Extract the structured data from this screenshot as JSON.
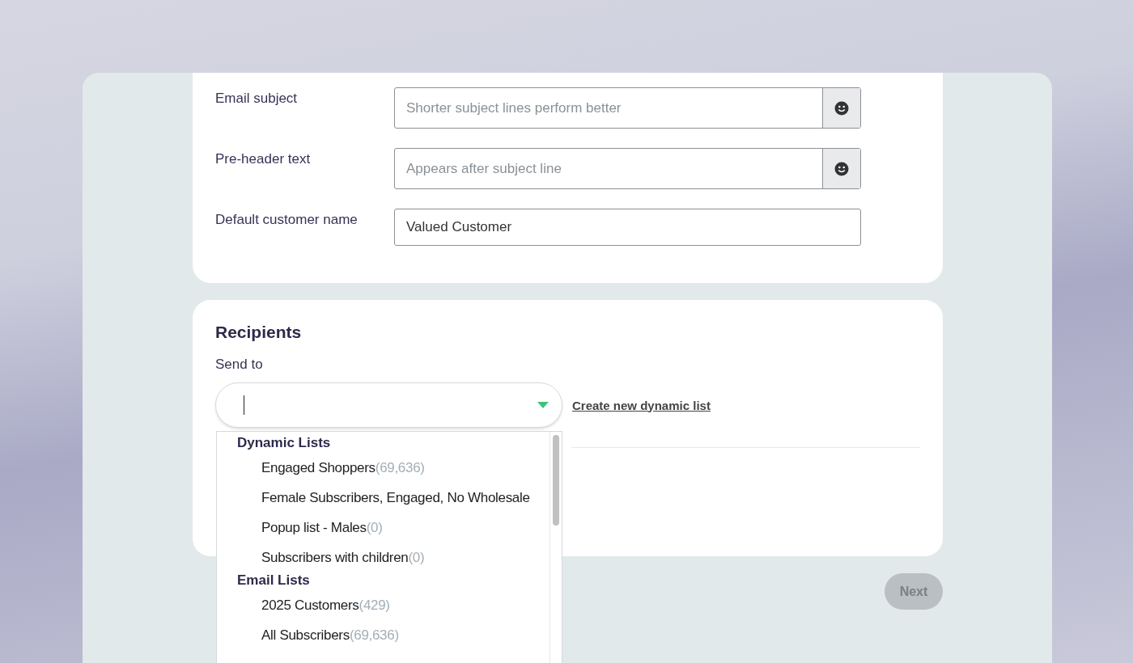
{
  "details": {
    "fields": [
      {
        "label": "Email subject",
        "placeholder": "Shorter subject lines perform better",
        "emoji": true
      },
      {
        "label": "Pre-header text",
        "placeholder": "Appears after subject line",
        "emoji": true
      },
      {
        "label": "Default customer name",
        "value": "Valued Customer",
        "emoji": false
      }
    ]
  },
  "recipients": {
    "title": "Recipients",
    "send_to_label": "Send to",
    "select": {
      "expanded": true
    },
    "create_link": "Create new dynamic list",
    "groups": [
      {
        "name": "Dynamic Lists",
        "items": [
          {
            "name": "Engaged Shoppers",
            "count": "(69,636)"
          },
          {
            "name": "Female Subscribers, Engaged, No Wholesale"
          },
          {
            "name": "Popup list - Males",
            "count": "(0)"
          },
          {
            "name": "Subscribers with children",
            "count": "(0)"
          }
        ]
      },
      {
        "name": "Email Lists",
        "items": [
          {
            "name": "2025 Customers",
            "count": "(429)"
          },
          {
            "name": "All Subscribers",
            "count": "(69,636)"
          }
        ]
      }
    ]
  },
  "next_button": {
    "label": "Next",
    "disabled": true
  }
}
